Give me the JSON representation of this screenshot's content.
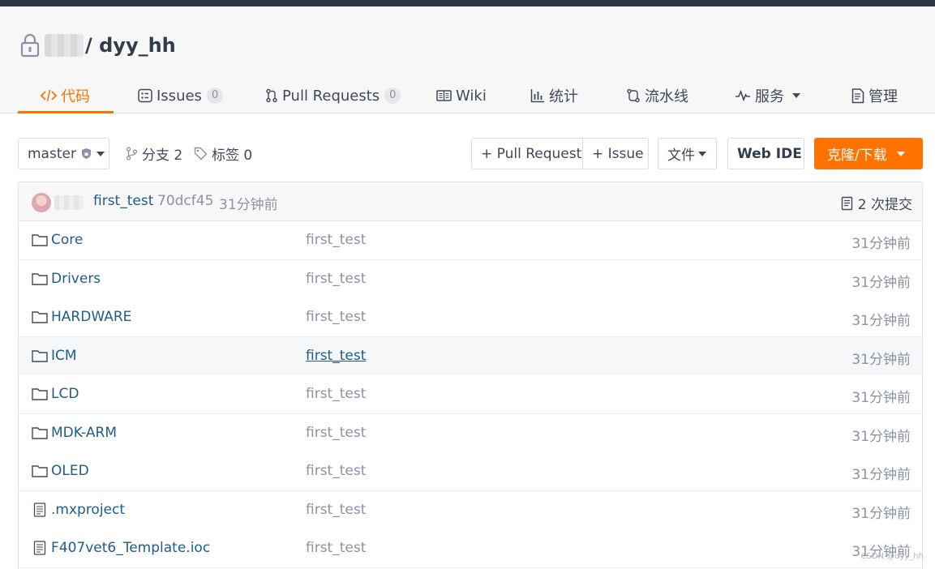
{
  "repo": {
    "owner": "",
    "name": "/ dyy_hh"
  },
  "tabs": [
    {
      "label": "代码",
      "icon": "code-icon",
      "active": true
    },
    {
      "label": "Issues",
      "icon": "issues-icon",
      "count": "0"
    },
    {
      "label": "Pull Requests",
      "icon": "pull-request-icon",
      "count": "0"
    },
    {
      "label": "Wiki",
      "icon": "book-icon"
    },
    {
      "label": "统计",
      "icon": "bar-chart-icon"
    },
    {
      "label": "流水线",
      "icon": "pipeline-icon"
    },
    {
      "label": "服务",
      "icon": "pulse-icon",
      "dropdown": true
    },
    {
      "label": "管理",
      "icon": "document-icon"
    }
  ],
  "toolbar": {
    "branch": "master",
    "branches": "分支 2",
    "tags": "标签 0",
    "new_pull_request": "+ Pull Request",
    "new_issue": "+ Issue",
    "file_menu": "文件",
    "web_ide": "Web IDE",
    "clone": "克隆/下载"
  },
  "commit": {
    "message": "first_test",
    "sha": "70dcf45",
    "time": "31分钟前",
    "count": "2 次提交"
  },
  "files": [
    {
      "name": "Core",
      "type": "folder",
      "message": "first_test",
      "time": "31分钟前"
    },
    {
      "name": "Drivers",
      "type": "folder",
      "message": "first_test",
      "time": "31分钟前"
    },
    {
      "name": "HARDWARE",
      "type": "folder",
      "message": "first_test",
      "time": "31分钟前"
    },
    {
      "name": "ICM",
      "type": "folder",
      "message": "first_test",
      "time": "31分钟前",
      "hover": true
    },
    {
      "name": "LCD",
      "type": "folder",
      "message": "first_test",
      "time": "31分钟前"
    },
    {
      "name": "MDK-ARM",
      "type": "folder",
      "message": "first_test",
      "time": "31分钟前"
    },
    {
      "name": "OLED",
      "type": "folder",
      "message": "first_test",
      "time": "31分钟前"
    },
    {
      "name": ".mxproject",
      "type": "file",
      "message": "first_test",
      "time": "31分钟前"
    },
    {
      "name": "F407vet6_Template.ioc",
      "type": "file",
      "message": "first_test",
      "time": "31分钟前"
    }
  ],
  "watermark": "CSDN @dyy_hh",
  "colors": {
    "accent": "#fe7300",
    "link": "#1f5c8c",
    "muted": "#8c92a4"
  }
}
